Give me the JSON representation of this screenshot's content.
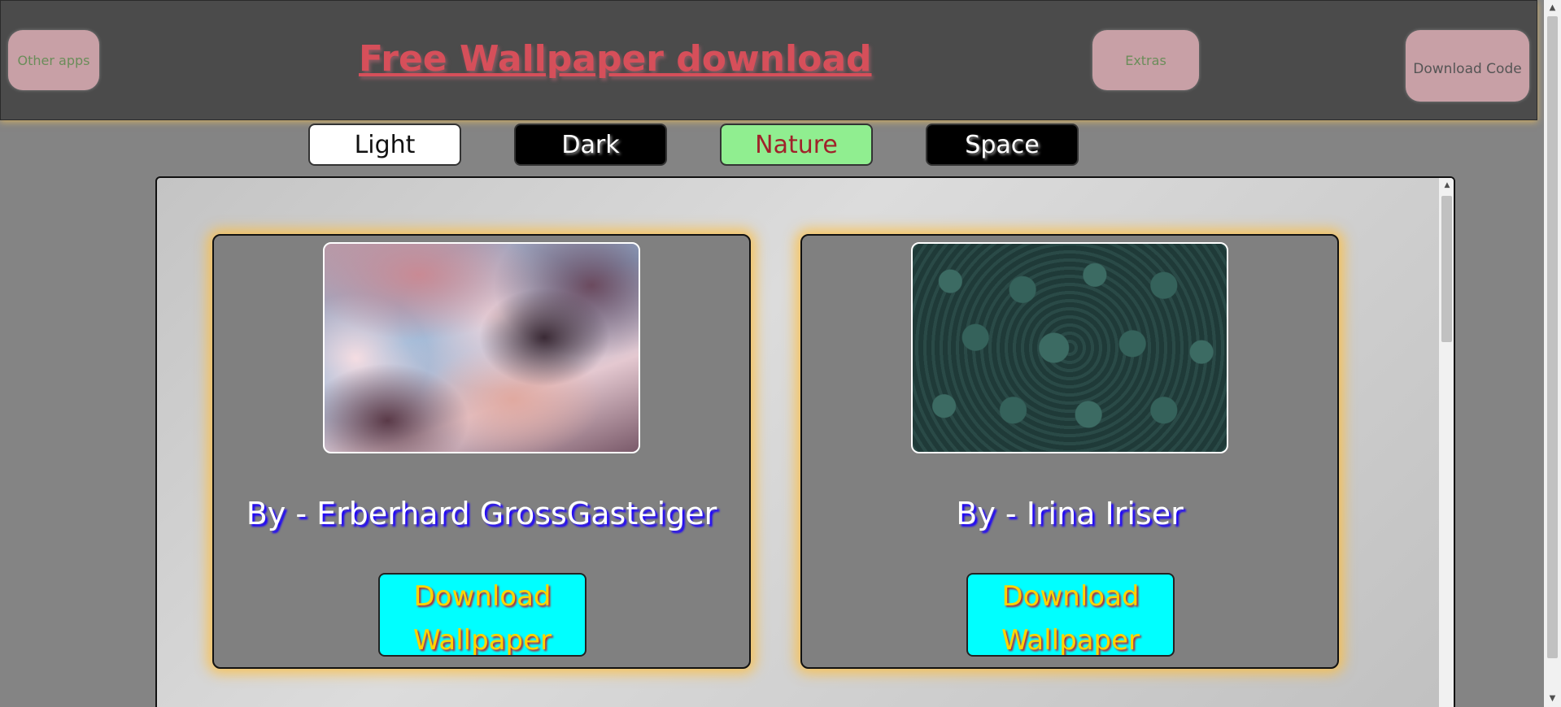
{
  "header": {
    "other_apps_label": "Other apps",
    "title": "Free Wallpaper download",
    "extras_label": "Extras",
    "download_code_label": "Download Code"
  },
  "categories": [
    {
      "label": "Light"
    },
    {
      "label": "Dark"
    },
    {
      "label": "Nature"
    },
    {
      "label": "Space"
    }
  ],
  "wallpapers": [
    {
      "author": "By - Erberhard GrossGasteiger",
      "image": "clouds-sky-image",
      "button_label": "Download Wallpaper"
    },
    {
      "author": "By - Irina Iriser",
      "image": "succulent-plants-image",
      "button_label": "Download Wallpaper"
    }
  ],
  "colors": {
    "header_bg": "#4b4b4b",
    "title": "#d64f5a",
    "card_bg": "#808080",
    "card_glow": "#ffbe3c",
    "download_bg": "#00ffff",
    "download_text": "#ffd400",
    "nature_bg": "#90ee90"
  }
}
